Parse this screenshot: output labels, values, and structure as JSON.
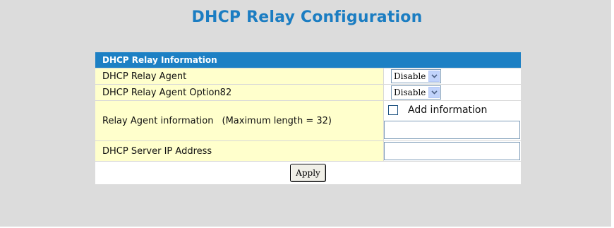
{
  "page": {
    "title": "DHCP Relay Configuration"
  },
  "panel": {
    "header": "DHCP Relay Information",
    "rows": {
      "relay_agent": {
        "label": "DHCP Relay Agent",
        "value": "Disable"
      },
      "option82": {
        "label": "DHCP Relay Agent Option82",
        "value": "Disable"
      },
      "relay_info": {
        "label": "Relay Agent information",
        "hint": "(Maximum length = 32)",
        "checkbox_label": "Add information",
        "checked": false,
        "value": ""
      },
      "server_ip": {
        "label": "DHCP Server IP Address",
        "value": ""
      }
    },
    "apply_label": "Apply"
  },
  "colors": {
    "title": "#1b7dc2",
    "header_bg": "#1d80c4",
    "label_bg": "#ffffcc",
    "page_bg": "#dcdcdc"
  }
}
